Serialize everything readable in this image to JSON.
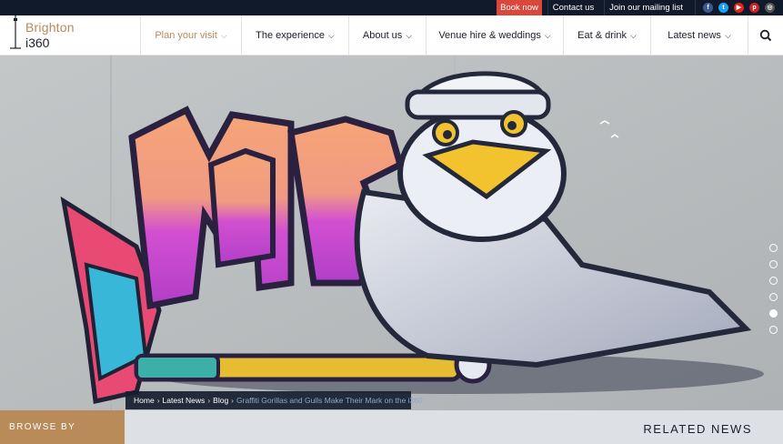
{
  "topbar": {
    "book_now": "Book now",
    "contact_us": "Contact us",
    "mailing_list": "Join our mailing list",
    "socials": [
      {
        "name": "facebook-icon",
        "glyph": "f",
        "color": "#3b5998"
      },
      {
        "name": "twitter-icon",
        "glyph": "t",
        "color": "#1da1f2"
      },
      {
        "name": "youtube-icon",
        "glyph": "▶",
        "color": "#e62117"
      },
      {
        "name": "pinterest-icon",
        "glyph": "p",
        "color": "#cb2027"
      },
      {
        "name": "instagram-icon",
        "glyph": "◎",
        "color": "#555555"
      }
    ]
  },
  "logo": {
    "line1": "Brighton",
    "line2": "i360"
  },
  "nav": {
    "items": [
      {
        "label": "Plan your visit",
        "active": true
      },
      {
        "label": "The experience"
      },
      {
        "label": "About us"
      },
      {
        "label": "Venue hire & weddings"
      },
      {
        "label": "Eat & drink"
      },
      {
        "label": "Latest news"
      }
    ]
  },
  "hero": {
    "slider_count": 6,
    "active_slide": 5,
    "graffiti_text": "MORE"
  },
  "breadcrumb": {
    "items": [
      "Home",
      "Latest News",
      "Blog"
    ],
    "current": "Graffiti Gorillas and Gulls Make Their Mark on the i360"
  },
  "bottom": {
    "browse_by": "BROWSE BY",
    "related_news": "RELATED NEWS"
  },
  "colors": {
    "accent": "#b88b59",
    "topbar": "#111a2b",
    "book_now": "#d9483b"
  }
}
